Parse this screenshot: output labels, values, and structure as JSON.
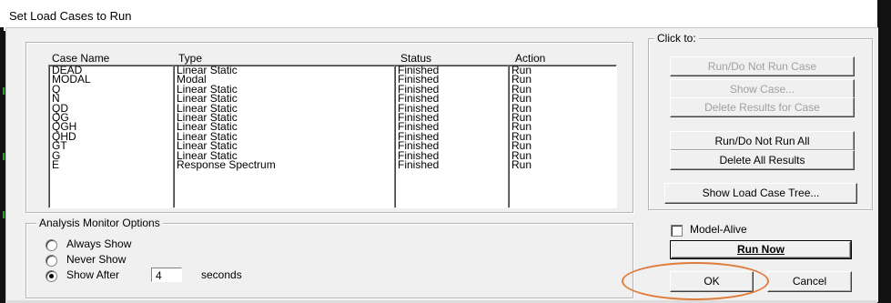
{
  "window": {
    "title": "Set Load Cases to Run"
  },
  "cases": {
    "headers": {
      "case_name": "Case Name",
      "type": "Type",
      "status": "Status",
      "action": "Action"
    },
    "rows": [
      {
        "name": "DEAD",
        "type": "Linear Static",
        "status": "Finished",
        "action": "Run"
      },
      {
        "name": "MODAL",
        "type": "Modal",
        "status": "Finished",
        "action": "Run"
      },
      {
        "name": "Q",
        "type": "Linear Static",
        "status": "Finished",
        "action": "Run"
      },
      {
        "name": "N",
        "type": "Linear Static",
        "status": "Finished",
        "action": "Run"
      },
      {
        "name": "QD",
        "type": "Linear Static",
        "status": "Finished",
        "action": "Run"
      },
      {
        "name": "QG",
        "type": "Linear Static",
        "status": "Finished",
        "action": "Run"
      },
      {
        "name": "QGH",
        "type": "Linear Static",
        "status": "Finished",
        "action": "Run"
      },
      {
        "name": "QHD",
        "type": "Linear Static",
        "status": "Finished",
        "action": "Run"
      },
      {
        "name": "GT",
        "type": "Linear Static",
        "status": "Finished",
        "action": "Run"
      },
      {
        "name": "G",
        "type": "Linear Static",
        "status": "Finished",
        "action": "Run"
      },
      {
        "name": "E",
        "type": "Response Spectrum",
        "status": "Finished",
        "action": "Run"
      }
    ]
  },
  "click_to": {
    "label": "Click to:",
    "run_do_not_run_case": "Run/Do Not Run Case",
    "show_case": "Show Case...",
    "delete_results_for_case": "Delete Results for Case",
    "run_do_not_run_all": "Run/Do Not Run All",
    "delete_all_results": "Delete All Results",
    "show_load_case_tree": "Show Load Case Tree..."
  },
  "monitor": {
    "label": "Analysis Monitor Options",
    "always_show": "Always Show",
    "never_show": "Never Show",
    "show_after": "Show After",
    "seconds_value": "4",
    "seconds_unit": "seconds",
    "selected": "show_after"
  },
  "model_alive": {
    "label": "Model-Alive",
    "checked": false
  },
  "buttons": {
    "run_now": "Run Now",
    "ok": "OK",
    "cancel": "Cancel"
  },
  "colors": {
    "highlight": "#e07b39",
    "disabled_text": "#a0a0a0"
  }
}
